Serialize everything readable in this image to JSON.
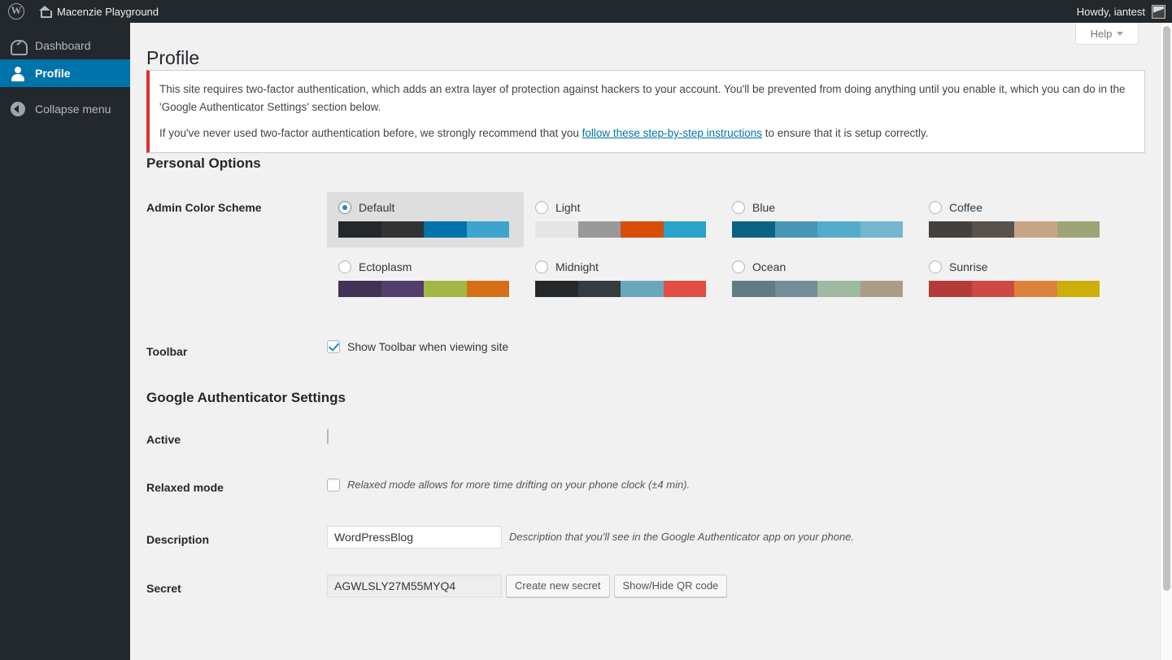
{
  "adminbar": {
    "wp_logo_icon": "wordpress-logo-icon",
    "home_icon": "home-icon",
    "site_name": "Macenzie Playground",
    "howdy": "Howdy, iantest",
    "avatar_icon": "avatar-image"
  },
  "sidebar": {
    "items": [
      {
        "label": "Dashboard",
        "icon": "dashboard-gauge-icon",
        "current": false
      },
      {
        "label": "Profile",
        "icon": "profile-person-icon",
        "current": true
      },
      {
        "label": "Collapse menu",
        "icon": "collapse-arrow-left-icon",
        "current": false
      }
    ]
  },
  "help_tab": {
    "label": "Help",
    "icon": "chevron-down-icon"
  },
  "page": {
    "title": "Profile"
  },
  "notice": {
    "paragraph1": "This site requires two-factor authentication, which adds an extra layer of protection against hackers to your account. You'll be prevented from doing anything until you enable it, which you can do in the 'Google Authenticator Settings' section below.",
    "paragraph2_before": "If you've never used two-factor authentication before, we strongly recommend that you ",
    "paragraph2_link": "follow these step-by-step instructions",
    "paragraph2_after": " to ensure that it is setup correctly.",
    "accent_color": "#dc3232"
  },
  "personal_options": {
    "heading": "Personal Options",
    "color_scheme": {
      "label": "Admin Color Scheme",
      "selected": "Default",
      "options": [
        {
          "name": "Default",
          "selected": true,
          "colors": [
            "#23282d",
            "#333333",
            "#0073aa",
            "#3ea4cc"
          ]
        },
        {
          "name": "Light",
          "selected": false,
          "colors": [
            "#e5e5e5",
            "#999999",
            "#d64e07",
            "#29a2cc"
          ]
        },
        {
          "name": "Blue",
          "selected": false,
          "colors": [
            "#096484",
            "#4796b3",
            "#52accc",
            "#74b6ce"
          ]
        },
        {
          "name": "Coffee",
          "selected": false,
          "colors": [
            "#46403c",
            "#59524c",
            "#c7a589",
            "#9ea476"
          ]
        },
        {
          "name": "Ectoplasm",
          "selected": false,
          "colors": [
            "#413256",
            "#523f6d",
            "#a3b745",
            "#d46f15"
          ]
        },
        {
          "name": "Midnight",
          "selected": false,
          "colors": [
            "#25282b",
            "#363b3f",
            "#69a8bb",
            "#e14d43"
          ]
        },
        {
          "name": "Ocean",
          "selected": false,
          "colors": [
            "#627c83",
            "#738e96",
            "#9ebaa0",
            "#aa9d88"
          ]
        },
        {
          "name": "Sunrise",
          "selected": false,
          "colors": [
            "#b43c38",
            "#cf4944",
            "#dd823b",
            "#ccaf0b"
          ]
        }
      ]
    },
    "toolbar": {
      "label": "Toolbar",
      "checkbox_label": "Show Toolbar when viewing site",
      "checked": true
    }
  },
  "google_authenticator": {
    "heading": "Google Authenticator Settings",
    "active": {
      "label": "Active",
      "checked": false
    },
    "relaxed": {
      "label": "Relaxed mode",
      "checked": false,
      "hint": "Relaxed mode allows for more time drifting on your phone clock (±4 min)."
    },
    "description": {
      "label": "Description",
      "value": "WordPressBlog",
      "hint": "Description that you'll see in the Google Authenticator app on your phone."
    },
    "secret": {
      "label": "Secret",
      "value": "AGWLSLY27M55MYQ4",
      "create_button": "Create new secret",
      "qr_button": "Show/Hide QR code"
    }
  }
}
